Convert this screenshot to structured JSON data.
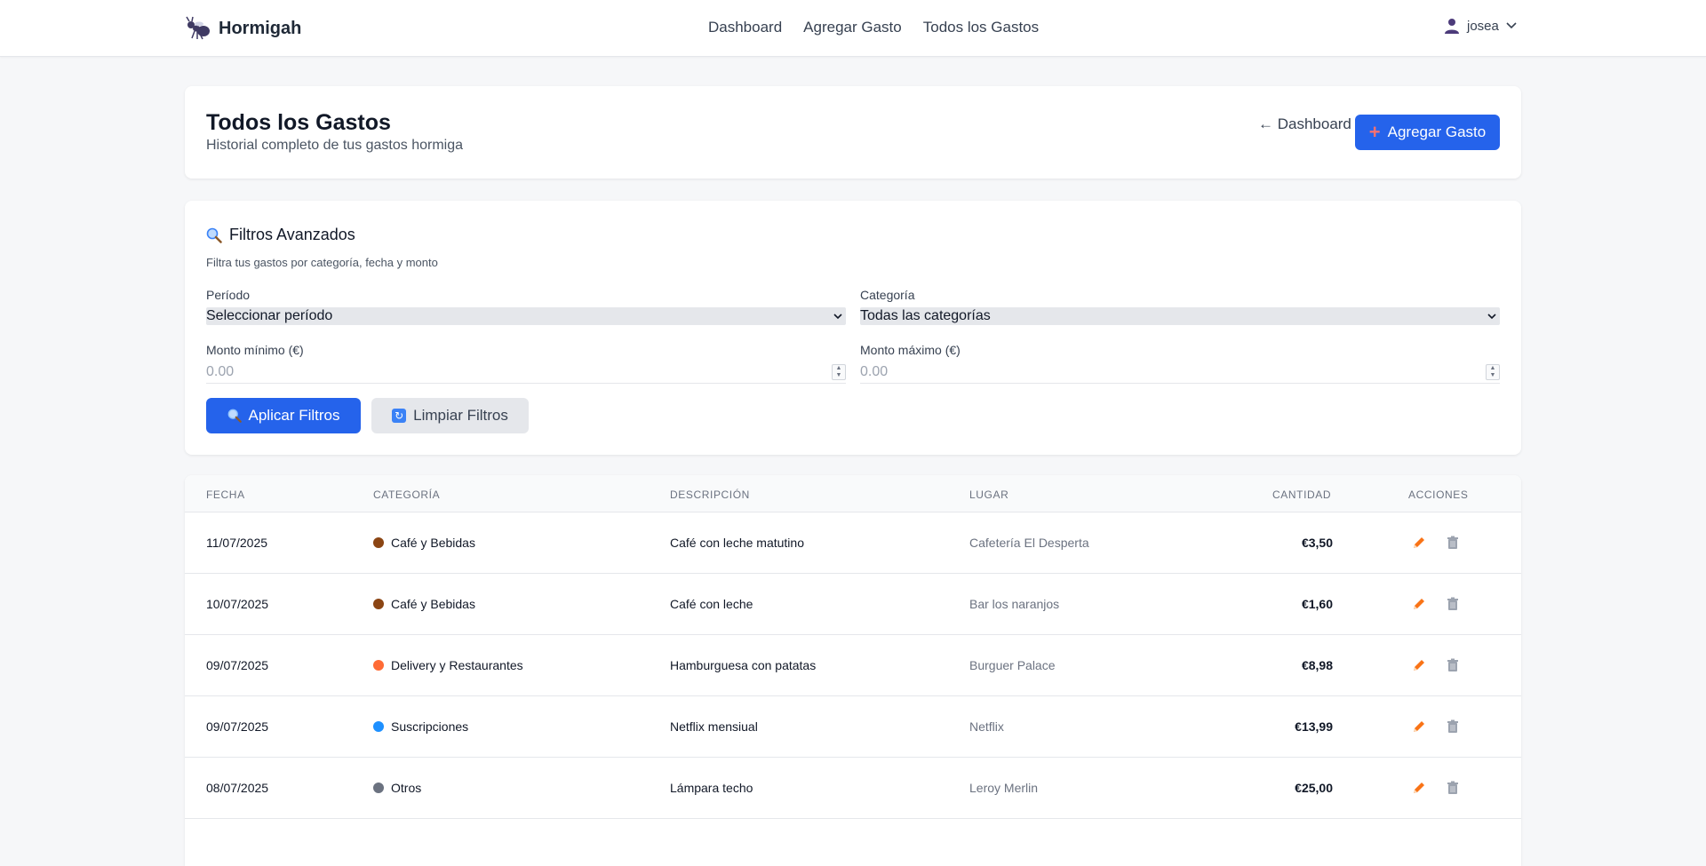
{
  "app": {
    "name": "Hormigah"
  },
  "nav": {
    "links": [
      "Dashboard",
      "Agregar Gasto",
      "Todos los Gastos"
    ],
    "user": "josea"
  },
  "header": {
    "title": "Todos los Gastos",
    "subtitle": "Historial completo de tus gastos hormiga",
    "back_label": "← Dashboard",
    "add_label": "Agregar Gasto"
  },
  "filters": {
    "title": "Filtros Avanzados",
    "description": "Filtra tus gastos por categoría, fecha y monto",
    "period_label": "Período",
    "period_value": "Seleccionar período",
    "category_label": "Categoría",
    "category_value": "Todas las categorías",
    "min_label": "Monto mínimo (€)",
    "min_placeholder": "0.00",
    "max_label": "Monto máximo (€)",
    "max_placeholder": "0.00",
    "apply_label": "Aplicar Filtros",
    "clear_label": "Limpiar Filtros"
  },
  "table": {
    "columns": [
      "Fecha",
      "Categoría",
      "Descripción",
      "Lugar",
      "Cantidad",
      "Acciones"
    ],
    "rows": [
      {
        "date": "11/07/2025",
        "category": "Café y Bebidas",
        "category_color": "#8b4513",
        "description": "Café con leche matutino",
        "place": "Cafetería El Desperta",
        "amount": "€3,50"
      },
      {
        "date": "10/07/2025",
        "category": "Café y Bebidas",
        "category_color": "#8b4513",
        "description": "Café con leche",
        "place": "Bar los naranjos",
        "amount": "€1,60"
      },
      {
        "date": "09/07/2025",
        "category": "Delivery y Restaurantes",
        "category_color": "#ff6b35",
        "description": "Hamburguesa con patatas",
        "place": "Burguer Palace",
        "amount": "€8,98"
      },
      {
        "date": "09/07/2025",
        "category": "Suscripciones",
        "category_color": "#1e90ff",
        "description": "Netflix mensiual",
        "place": "Netflix",
        "amount": "€13,99"
      },
      {
        "date": "08/07/2025",
        "category": "Otros",
        "category_color": "#6b7280",
        "description": "Lámpara techo",
        "place": "Leroy Merlin",
        "amount": "€25,00"
      }
    ]
  },
  "colors": {
    "primary": "#2563eb",
    "edit_icon": "#f97316",
    "delete_icon": "#9ca3af"
  }
}
